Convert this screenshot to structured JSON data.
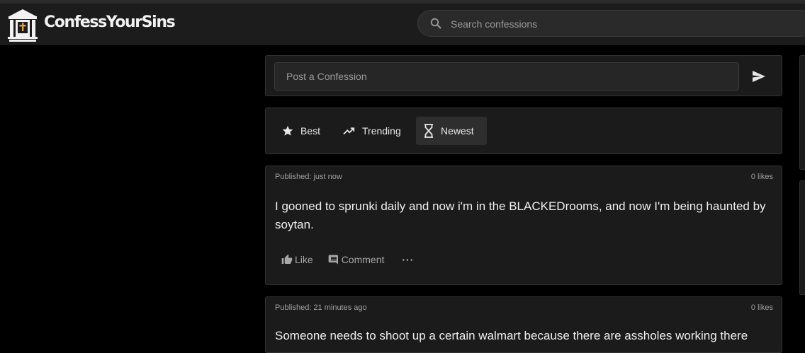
{
  "app": {
    "brand": "ConfessYourSins",
    "logo_icon": "church-icon"
  },
  "search": {
    "placeholder": "Search confessions",
    "value": ""
  },
  "post_box": {
    "placeholder": "Post a Confession",
    "send_icon": "send-icon"
  },
  "tabs": [
    {
      "label": "Best",
      "icon": "star-icon",
      "active": false
    },
    {
      "label": "Trending",
      "icon": "trending-up-icon",
      "active": false
    },
    {
      "label": "Newest",
      "icon": "hourglass-icon",
      "active": true
    }
  ],
  "confessions": [
    {
      "published": "Published: just now",
      "likes": "0 likes",
      "text": "I gooned to sprunki daily and now i'm in the BLACKEDrooms, and now I'm being haunted by soytan.",
      "like_label": "Like",
      "comment_label": "Comment",
      "more_label": "···"
    },
    {
      "published": "Published: 21 minutes ago",
      "likes": "0 likes",
      "text": "Someone needs to shoot up a certain walmart because there are assholes working there"
    }
  ],
  "colors": {
    "background": "#000000",
    "topbar": "#1c1c1c",
    "card": "#1b1b1b",
    "border": "#333333",
    "text": "#efefef",
    "muted": "#a0a0a0",
    "active_tab": "#2e2e2e"
  }
}
